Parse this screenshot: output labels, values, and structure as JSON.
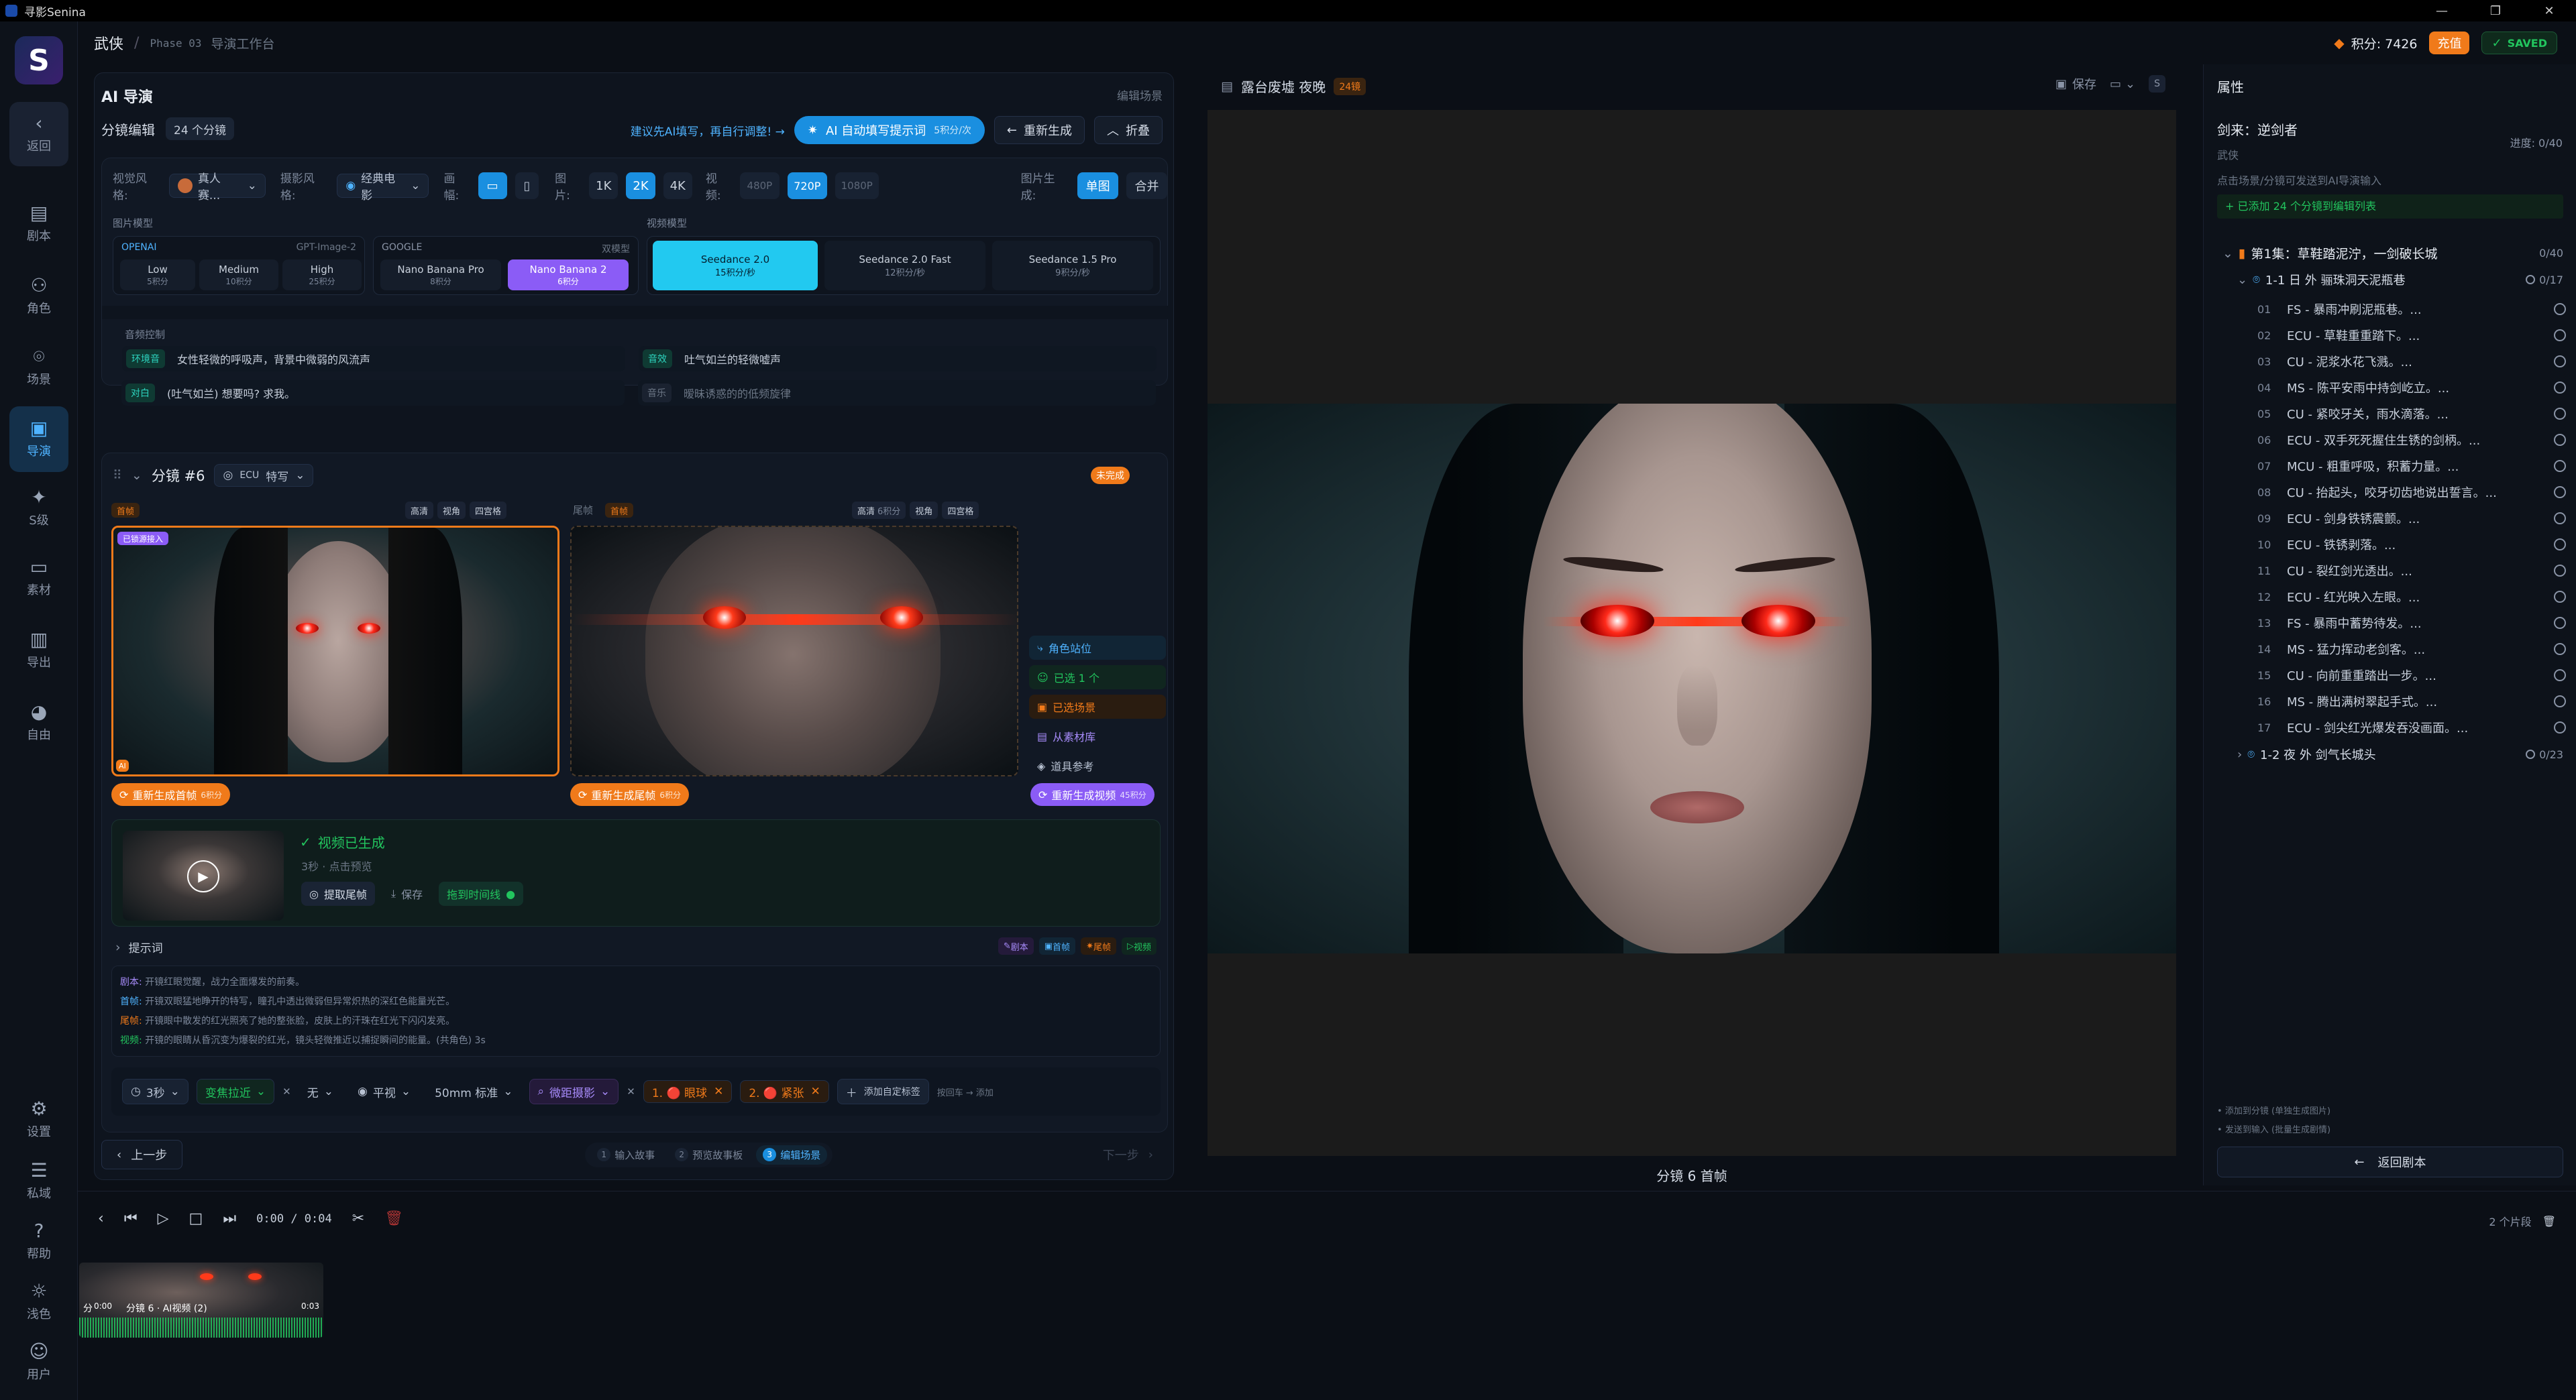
{
  "app_title": "寻影Senina",
  "header": {
    "genre": "武侠",
    "phase": "Phase 03",
    "workspace": "导演工作台",
    "points_label": "积分: 7426",
    "recharge": "充值",
    "saved": "SAVED"
  },
  "sidebar": {
    "back": "返回",
    "items": [
      "剧本",
      "角色",
      "场景",
      "导演",
      "S级",
      "素材",
      "导出",
      "自由"
    ],
    "bottom": [
      "设置",
      "私域",
      "帮助",
      "浅色",
      "用户"
    ]
  },
  "director": {
    "title": "AI 导演",
    "edit_scene": "编辑场景",
    "storyboard_label": "分镜编辑",
    "storyboard_count": "24 个分镜",
    "suggest": "建议先AI填写，再自行调整!",
    "auto_fill": "AI 自动填写提示词",
    "auto_fill_cost": "5积分/次",
    "regenerate": "重新生成",
    "collapse": "折叠",
    "visual_style_label": "视觉风格:",
    "visual_style": "真人赛...",
    "camera_style_label": "摄影风格:",
    "camera_style": "经典电影",
    "frame_label": "画幅:",
    "image_label": "图片:",
    "res_image": [
      "1K",
      "2K",
      "4K"
    ],
    "video_label": "视频:",
    "res_video": [
      "480P",
      "720P",
      "1080P"
    ],
    "image_gen_label": "图片生成:",
    "image_gen_opts": [
      "单图",
      "合并"
    ],
    "image_model_label": "图片模型",
    "openai": "OPENAI",
    "gpt_model": "GPT-Image-2",
    "openai_opts": [
      {
        "name": "Low",
        "cost": "5积分"
      },
      {
        "name": "Medium",
        "cost": "10积分"
      },
      {
        "name": "High",
        "cost": "25积分"
      }
    ],
    "google": "GOOGLE",
    "dual_model": "双模型",
    "google_opts": [
      {
        "name": "Nano Banana Pro",
        "cost": "8积分"
      },
      {
        "name": "Nano Banana 2",
        "cost": "6积分"
      }
    ],
    "video_model_label": "视频模型",
    "video_models": [
      {
        "name": "Seedance 2.0",
        "cost": "15积分/秒"
      },
      {
        "name": "Seedance 2.0 Fast",
        "cost": "12积分/秒"
      },
      {
        "name": "Seedance 1.5 Pro",
        "cost": "9积分/秒"
      }
    ],
    "audio_label": "音频控制",
    "ambient_tag": "环境音",
    "ambient_text": "女性轻微的呼吸声，背景中微弱的风流声",
    "sfx_tag": "音效",
    "sfx_text": "吐气如兰的轻微嘘声",
    "dialogue_tag": "对白",
    "dialogue_text": "(吐气如兰) 想要吗? 求我。",
    "music_tag": "音乐",
    "music_text": "暧昧诱惑的的低频旋律"
  },
  "shot": {
    "label": "分镜 #6",
    "shot_type": "ECU",
    "shot_name": "特写",
    "status": "未完成",
    "first_frame": "首帧",
    "last_frame": "尾帧",
    "hd": "高清",
    "hd_cost": "6积分",
    "view": "视角",
    "grid": "四宫格",
    "locked_badge": "已锁源接入",
    "ai_badge": "AI",
    "regen_first": "重新生成首帧",
    "regen_first_cost": "6积分",
    "regen_last": "重新生成尾帧",
    "regen_last_cost": "6积分",
    "regen_video": "重新生成视频",
    "regen_video_cost": "45积分",
    "opts": [
      "角色站位",
      "已选 1 个",
      "已选场景",
      "从素材库",
      "道具参考"
    ],
    "video_done": "视频已生成",
    "video_meta": "3秒 · 点击预览",
    "extract_last": "提取尾帧",
    "save": "保存",
    "drag_timeline": "拖到时间线",
    "prompt_label": "提示词",
    "prompt_tags": [
      "剧本",
      "首帧",
      "尾帧",
      "视频"
    ],
    "prompt_lines": [
      {
        "k": "剧本:",
        "v": "开镜红眼觉醒，战力全面爆发的前奏。"
      },
      {
        "k": "首帧:",
        "v": "开镜双眼猛地睁开的特写，瞳孔中透出微弱但异常炽热的深红色能量光芒。"
      },
      {
        "k": "尾帧:",
        "v": "开镜眼中散发的红光照亮了她的整张脸，皮肤上的汗珠在红光下闪闪发亮。"
      },
      {
        "k": "视频:",
        "v": "开镜的眼睛从昏沉变为爆裂的红光，镜头轻微推近以捕捉瞬间的能量。(共角色) 3s"
      }
    ],
    "duration": "3秒",
    "move": "变焦拉近",
    "none": "无",
    "angle": "平视",
    "lens": "50mm 标准",
    "micro": "微距摄影",
    "ref1": "1. 🔴 眼球",
    "ref2": "2. 🔴 紧张",
    "add_custom": "添加自定标签",
    "add_hint": "按回车 → 添加"
  },
  "footer_nav": {
    "prev": "上一步",
    "steps": [
      "输入故事",
      "预览故事板",
      "编辑场景"
    ],
    "next": "下一步"
  },
  "preview": {
    "title": "露台废墟 夜晚",
    "badge": "24镜",
    "save": "保存",
    "caption": "分镜 6 首帧",
    "s": "S"
  },
  "props": {
    "title": "属性",
    "name": "剑来：逆剑者",
    "progress": "进度: 0/40",
    "genre": "武侠",
    "hint": "点击场景/分镜可发送到AI导演输入",
    "added": "+ 已添加 24 个分镜到编辑列表",
    "episode": "第1集：草鞋踏泥泞，一剑破长城",
    "episode_count": "0/40",
    "scene1": "1-1 日 外 骊珠洞天泥瓶巷",
    "scene1_count": "0/17",
    "scene2": "1-2 夜 外 剑气长城头",
    "scene2_count": "0/23",
    "shots": [
      {
        "n": "01",
        "t": "FS - 暴雨冲刷泥瓶巷。..."
      },
      {
        "n": "02",
        "t": "ECU - 草鞋重重踏下。..."
      },
      {
        "n": "03",
        "t": "CU - 泥浆水花飞溅。..."
      },
      {
        "n": "04",
        "t": "MS - 陈平安雨中持剑屹立。..."
      },
      {
        "n": "05",
        "t": "CU - 紧咬牙关，雨水滴落。..."
      },
      {
        "n": "06",
        "t": "ECU - 双手死死握住生锈的剑柄。..."
      },
      {
        "n": "07",
        "t": "MCU - 粗重呼吸，积蓄力量。..."
      },
      {
        "n": "08",
        "t": "CU - 抬起头，咬牙切齿地说出誓言。..."
      },
      {
        "n": "09",
        "t": "ECU - 剑身铁锈震颤。..."
      },
      {
        "n": "10",
        "t": "ECU - 铁锈剥落。..."
      },
      {
        "n": "11",
        "t": "CU - 裂红剑光透出。..."
      },
      {
        "n": "12",
        "t": "ECU - 红光映入左眼。..."
      },
      {
        "n": "13",
        "t": "FS - 暴雨中蓄势待发。..."
      },
      {
        "n": "14",
        "t": "MS - 猛力挥动老剑客。..."
      },
      {
        "n": "15",
        "t": "CU - 向前重重踏出一步。..."
      },
      {
        "n": "16",
        "t": "MS - 腾出满树翠起手式。..."
      },
      {
        "n": "17",
        "t": "ECU - 剑尖红光爆发吞没画面。..."
      }
    ],
    "add_to_shot": "添加到分镜 (单独生成图片)",
    "send_ai": "发送到输入 (批量生成剧情)",
    "back_script": "返回剧本"
  },
  "timeline": {
    "time": "0:00 / 0:04",
    "clip_count": "2 个片段",
    "clip1": "分镜 6 · AI视频 (2)",
    "clip_tag": "分",
    "t0": "0:00",
    "t1": "0:03"
  },
  "colors": {
    "accent": "#1aa3e8",
    "purple": "#8b5cf6",
    "orange": "#f07a1a",
    "green": "#22c55e"
  }
}
